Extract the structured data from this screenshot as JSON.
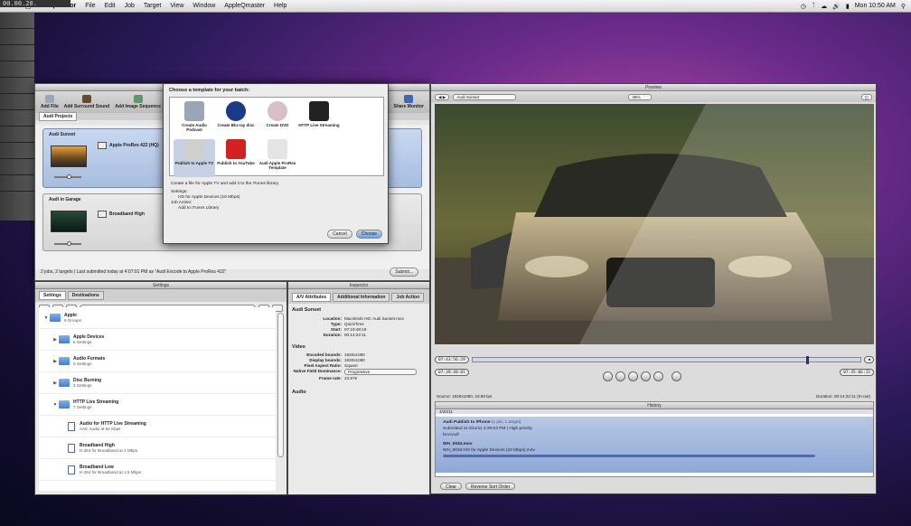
{
  "corner_timecode": "00.00.20.",
  "menubar": {
    "app_name": "Compressor",
    "items": [
      "File",
      "Edit",
      "Job",
      "Target",
      "View",
      "Window",
      "AppleQmaster",
      "Help"
    ],
    "clock": "Mon 10:50 AM"
  },
  "batch": {
    "toolbar": [
      "Add File",
      "Add Surround Sound",
      "Add Image Sequence"
    ],
    "share_monitor": "Share Monitor",
    "tab": "Audi Projects",
    "jobs": [
      {
        "name": "Audi Sunset",
        "preset": "Apple ProRes 422 (HQ)"
      },
      {
        "name": "Audi in Garage",
        "preset": "Broadband High"
      }
    ],
    "status": "2 jobs, 2 targets  |  Last submitted today at 4:07:01 PM as “Audi Encode to Apple ProRes 422”",
    "submit": "Submit..."
  },
  "template": {
    "heading": "Choose a template for your batch:",
    "items": [
      {
        "label": "Create Audio Podcast",
        "icon": "podcast-icon",
        "color": "#9aa6b8"
      },
      {
        "label": "Create Blu-ray disc",
        "icon": "bluray-disc-icon",
        "color": "#1a3a8a"
      },
      {
        "label": "Create DVD",
        "icon": "dvd-disc-icon",
        "color": "#d8c0c8"
      },
      {
        "label": "HTTP Live Streaming",
        "icon": "streaming-icon",
        "color": "#222222"
      },
      {
        "label": "Publish to Apple TV",
        "icon": "apple-tv-icon",
        "color": "#cfcfcf"
      },
      {
        "label": "Publish to YouTube",
        "icon": "youtube-icon",
        "color": "#d42020"
      },
      {
        "label": "Audi Apple ProRes Template",
        "icon": "template-icon",
        "color": "#e4e4e4"
      }
    ],
    "selected": "Publish to Apple TV",
    "description": "Create a file for Apple TV and add it to the iTunes library",
    "settings_label": "Settings:",
    "settings_value": "HD for Apple Devices (10 Mbps)",
    "job_action_label": "Job Action:",
    "job_action_value": "Add to iTunes Library",
    "cancel": "Cancel",
    "choose": "Choose"
  },
  "settings": {
    "title": "Settings",
    "tabs": [
      "Settings",
      "Destinations"
    ],
    "tree": [
      {
        "name": "Apple",
        "sub": "9 Groups",
        "type": "folder",
        "open": true,
        "indent": 0
      },
      {
        "name": "Apple Devices",
        "sub": "5 Settings",
        "type": "folder",
        "open": false,
        "indent": 1
      },
      {
        "name": "Audio Formats",
        "sub": "6 Settings",
        "type": "folder",
        "open": false,
        "indent": 1
      },
      {
        "name": "Disc Burning",
        "sub": "3 Settings",
        "type": "folder",
        "open": false,
        "indent": 1
      },
      {
        "name": "HTTP Live Streaming",
        "sub": "7 Settings",
        "type": "folder",
        "open": true,
        "indent": 1
      },
      {
        "name": "Audio for HTTP Live Streaming",
        "sub": "AAC Audio at 64 Kbps",
        "type": "doc",
        "open": false,
        "indent": 2
      },
      {
        "name": "Broadband High",
        "sub": "H.264 for Broadband at 1 Mbps",
        "type": "doc",
        "open": false,
        "indent": 2
      },
      {
        "name": "Broadband Low",
        "sub": "H.264 for Broadband at 1.5 Mbps",
        "type": "doc",
        "open": false,
        "indent": 2
      }
    ]
  },
  "inspector": {
    "title": "Inspector",
    "tabs": [
      "A/V Attributes",
      "Additional Information",
      "Job Action"
    ],
    "clip": "Audi Sunset",
    "location_label": "Location:",
    "location": "Macintosh HD: Audi Sunset.mov",
    "type_label": "Type:",
    "type": "QuickTime",
    "start_label": "Start:",
    "start": "07:19:48:19",
    "duration_label": "Duration:",
    "duration": "00:14:22:11",
    "video_heading": "Video",
    "encoded_label": "Encoded bounds:",
    "encoded": "1920x1080",
    "display_label": "Display bounds:",
    "display": "1920x1080",
    "pixel_label": "Pixel Aspect Ratio:",
    "pixel": "Square",
    "field_label": "Native Field Dominance:",
    "field": "Progressive",
    "frame_label": "Frame rate:",
    "frame": "23.976",
    "audio_heading": "Audio"
  },
  "preview": {
    "title": "Preview",
    "clip": "Audi Sunset",
    "zoom": "48%",
    "tc_in": "07:43:56:29",
    "tc_left": "07:39:48:01",
    "tc_right": "07:45:06:15",
    "source": "Source: 1920x1080, 23.98 fps",
    "duration": "Duration: 00:14:22:11 (In-out)",
    "playhead": 0.86
  },
  "history": {
    "title": "History",
    "date": "4/20/11",
    "job": "Audi Publish to iPhone",
    "job_meta": "(1 job, 1 target)",
    "submitted": "Submitted at 4/11/11 2:29:04 PM  |  High priority",
    "user": "bcvcnufr",
    "file": "WH_0034.mov",
    "target": "WH_0034-HD for Apple Devices (10 Mbps).m4v",
    "clear": "Clear",
    "reverse": "Reverse Sort Order"
  }
}
